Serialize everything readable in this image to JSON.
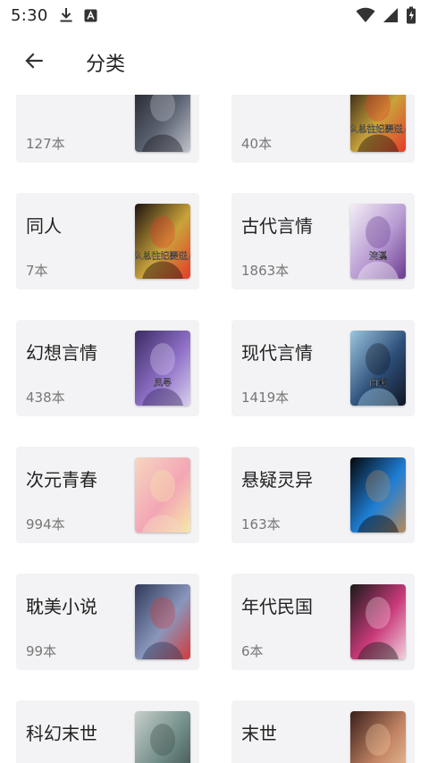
{
  "status_bar": {
    "time": "5:30",
    "icons": [
      "download-icon",
      "a-badge-icon",
      "wifi-icon",
      "signal-icon",
      "battery-icon"
    ]
  },
  "app_bar": {
    "title": "分类",
    "back_icon": "arrow-left-icon"
  },
  "categories": [
    {
      "name": "",
      "count": "127本",
      "cover": {
        "colors": [
          "#1e1f26",
          "#5a6170",
          "#bfc3cc"
        ]
      }
    },
    {
      "name": "",
      "count": "40本",
      "cover": {
        "text": "怎么总往妃要送人?",
        "colors": [
          "#1f1410",
          "#c9a33a",
          "#e63a2a"
        ]
      }
    },
    {
      "name": "同人",
      "count": "7本",
      "cover": {
        "text": "怎么总往妃要送人?",
        "colors": [
          "#1f1410",
          "#c9a33a",
          "#e63a2a"
        ]
      }
    },
    {
      "name": "古代言情",
      "count": "1863本",
      "cover": {
        "text": "浣溪",
        "colors": [
          "#f4eef6",
          "#b79ad2",
          "#6b3b8f"
        ]
      }
    },
    {
      "name": "幻想言情",
      "count": "438本",
      "cover": {
        "text": "凤寻",
        "colors": [
          "#3a2c63",
          "#8e6fc6",
          "#d9cfee"
        ]
      }
    },
    {
      "name": "现代言情",
      "count": "1419本",
      "cover": {
        "text": "白熊",
        "colors": [
          "#9bc6dd",
          "#2d4f7a",
          "#111622"
        ]
      }
    },
    {
      "name": "次元青春",
      "count": "994本",
      "cover": {
        "colors": [
          "#f6d6c0",
          "#f3a6b5",
          "#f7e9a8"
        ]
      }
    },
    {
      "name": "悬疑灵异",
      "count": "163本",
      "cover": {
        "colors": [
          "#05080c",
          "#1f7fd6",
          "#b98a5a"
        ]
      }
    },
    {
      "name": "耽美小说",
      "count": "99本",
      "cover": {
        "colors": [
          "#2f3a5a",
          "#8a96bc",
          "#d23a3a"
        ]
      }
    },
    {
      "name": "年代民国",
      "count": "6本",
      "cover": {
        "colors": [
          "#1a1a1a",
          "#c93a7a",
          "#f0d2de"
        ]
      }
    },
    {
      "name": "科幻末世",
      "count": "",
      "cover": {
        "colors": [
          "#c7cfcb",
          "#6f8b86",
          "#3b4a48"
        ]
      }
    },
    {
      "name": "末世",
      "count": "",
      "cover": {
        "colors": [
          "#3a1f1a",
          "#c28464",
          "#f0c8a0"
        ]
      }
    }
  ]
}
